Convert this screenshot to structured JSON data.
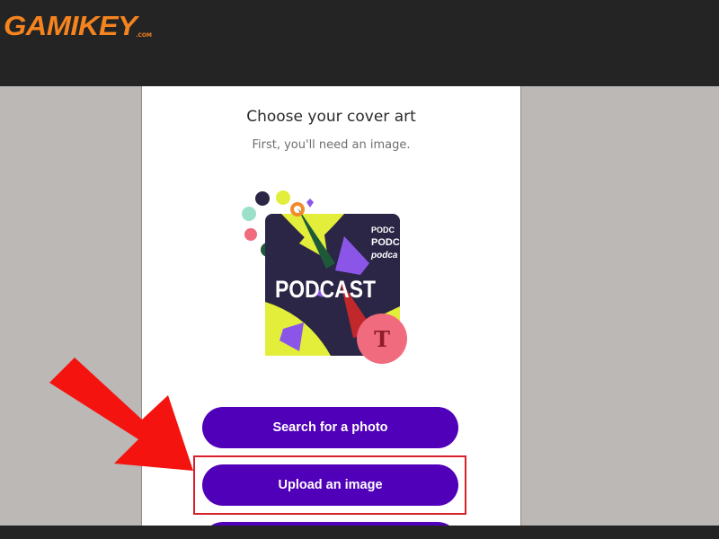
{
  "logo": {
    "text": "GAMIKEY",
    "suffix": ".COM"
  },
  "dialog": {
    "title": "Choose your cover art",
    "subtitle": "First, you'll need an image."
  },
  "cover_art": {
    "main_text": "PODCAST",
    "side_text": [
      "PODC",
      "PODC",
      "podca"
    ],
    "badge_letter": "T"
  },
  "buttons": {
    "search": "Search for a photo",
    "upload": "Upload an image"
  },
  "colors": {
    "button": "#5000b9",
    "highlight": "#d8202b",
    "arrow": "#f4130f",
    "logo": "#f5841f"
  }
}
